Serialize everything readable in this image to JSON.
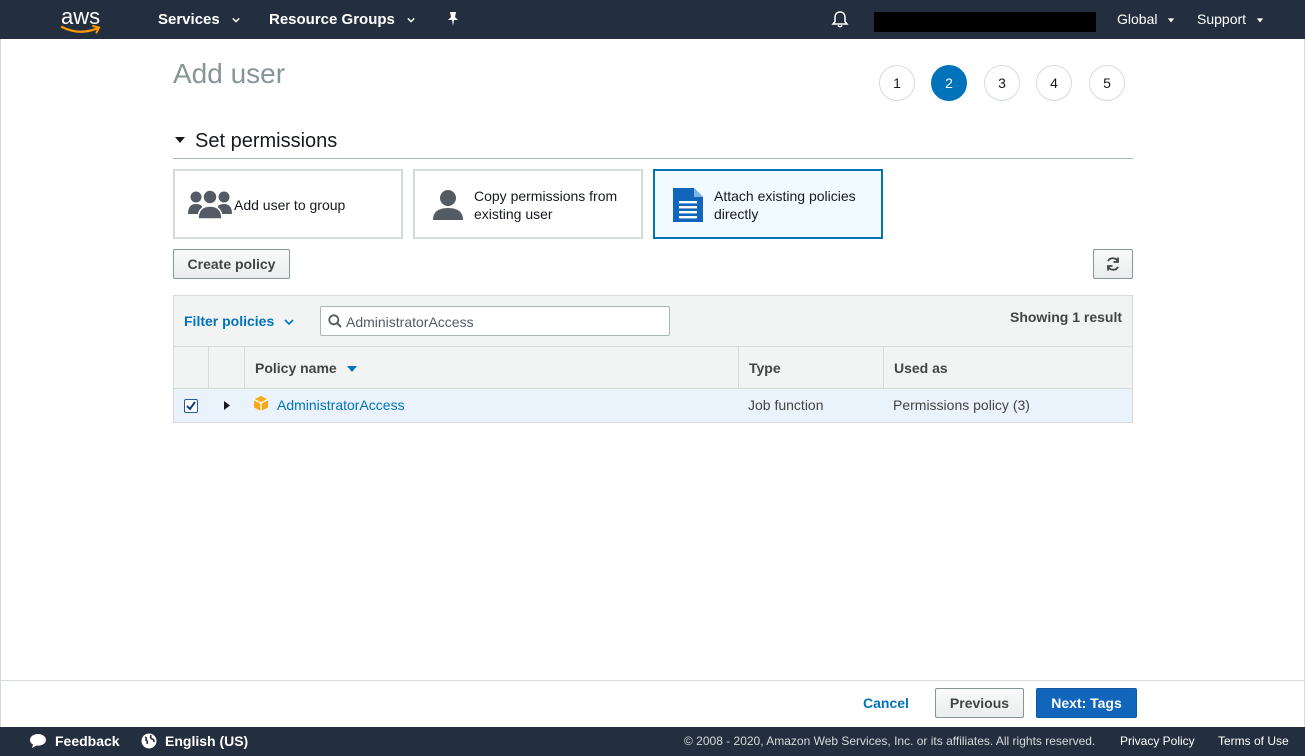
{
  "topnav": {
    "logo": "aws",
    "services": "Services",
    "resource_groups": "Resource Groups",
    "region": "Global",
    "support": "Support",
    "icons": [
      "pin-icon",
      "bell-icon"
    ]
  },
  "page": {
    "title": "Add user",
    "steps": [
      "1",
      "2",
      "3",
      "4",
      "5"
    ],
    "active_step": "2"
  },
  "permissions": {
    "section_title": "Set permissions",
    "options": [
      {
        "label": "Add user to group",
        "icon": "group-icon"
      },
      {
        "label": "Copy permissions from existing user",
        "icon": "user-icon"
      },
      {
        "label": "Attach existing policies directly",
        "icon": "document-icon"
      }
    ],
    "selected_option": "Attach existing policies directly"
  },
  "toolbar": {
    "create_policy": "Create policy",
    "refresh_icon": "refresh-icon"
  },
  "filter": {
    "dropdown_label": "Filter policies",
    "search_value": "AdministratorAccess",
    "result_count": "Showing 1 result"
  },
  "table": {
    "columns": [
      "Policy name",
      "Type",
      "Used as"
    ],
    "rows": [
      {
        "checked": true,
        "name": "AdministratorAccess",
        "type": "Job function",
        "used_as": "Permissions policy (3)"
      }
    ]
  },
  "actions": {
    "cancel": "Cancel",
    "previous": "Previous",
    "next": "Next: Tags"
  },
  "footer": {
    "feedback": "Feedback",
    "language": "English (US)",
    "copyright": "© 2008 - 2020, Amazon Web Services, Inc. or its affiliates. All rights reserved.",
    "privacy": "Privacy Policy",
    "terms": "Terms of Use"
  },
  "colors": {
    "nav_bg": "#232f3e",
    "accent": "#0073bb",
    "selected_bg": "#f1faff",
    "row_highlight": "#eaf3fb",
    "aws_orange": "#ff9900"
  }
}
